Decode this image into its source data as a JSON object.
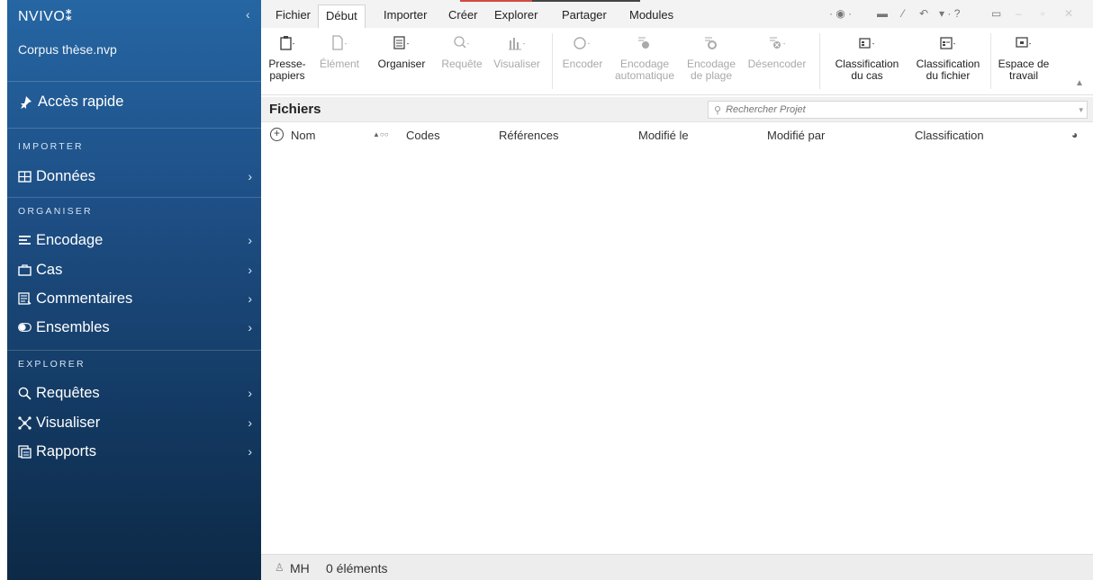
{
  "sidebar": {
    "brand": "NVIVO",
    "brand_mark": "⁑",
    "collapse_glyph": "‹",
    "project": "Corpus thèse.nvp",
    "quick_access": "Accès rapide",
    "sections": {
      "importer": "IMPORTER",
      "organiser": "ORGANISER",
      "explorer": "EXPLORER"
    },
    "items": [
      {
        "label": "Données",
        "icon": "table-icon"
      },
      {
        "label": "Encodage",
        "icon": "lines-icon"
      },
      {
        "label": "Cas",
        "icon": "briefcase-icon"
      },
      {
        "label": "Commentaires",
        "icon": "memo-icon"
      },
      {
        "label": "Ensembles",
        "icon": "toggle-icon"
      },
      {
        "label": "Requêtes",
        "icon": "magnifier-icon"
      },
      {
        "label": "Visualiser",
        "icon": "network-icon"
      },
      {
        "label": "Rapports",
        "icon": "report-icon"
      }
    ]
  },
  "tabs": {
    "fichier": "Fichier",
    "debut": "Début",
    "importer": "Importer",
    "creer": "Créer",
    "explorer": "Explorer",
    "partager": "Partager",
    "modules": "Modules"
  },
  "ribbon": {
    "presse_papiers": [
      "Presse-",
      "papiers"
    ],
    "element": "Élément",
    "organiser": "Organiser",
    "requete": "Requête",
    "visualiser": "Visualiser",
    "encoder": "Encoder",
    "encodage_auto": [
      "Encodage",
      "automatique"
    ],
    "encodage_plage": [
      "Encodage",
      "de plage"
    ],
    "desencoder": "Désencoder",
    "classif_cas": [
      "Classification",
      "du cas"
    ],
    "classif_fichier": [
      "Classification",
      "du fichier"
    ],
    "espace_travail": [
      "Espace de",
      "travail"
    ]
  },
  "files": {
    "title": "Fichiers",
    "search_placeholder": "Rechercher Projet",
    "columns": {
      "nom": "Nom",
      "codes": "Codes",
      "references": "Références",
      "modifie_le": "Modifié le",
      "modifie_par": "Modifié par",
      "classification": "Classification"
    }
  },
  "status": {
    "user": "MH",
    "count": "0 éléments"
  },
  "colors": {
    "sidebar_top": "#2566a3",
    "sidebar_bottom": "#0d2946",
    "accent_red": "#d24a43"
  }
}
